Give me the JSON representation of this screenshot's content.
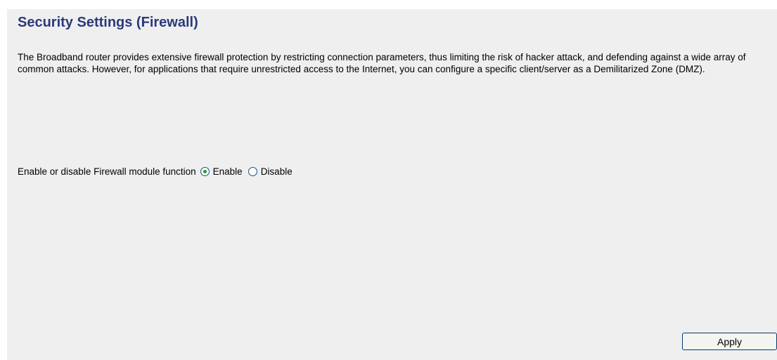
{
  "page": {
    "title": "Security Settings (Firewall)",
    "description": "The Broadband router provides extensive firewall protection by restricting connection parameters, thus limiting the risk of hacker attack, and defending against a wide array of common attacks. However, for applications that require unrestricted access to the Internet, you can configure a specific client/server as a Demilitarized Zone (DMZ)."
  },
  "firewall": {
    "label": "Enable or disable Firewall module function",
    "options": [
      {
        "label": "Enable",
        "selected": true
      },
      {
        "label": "Disable",
        "selected": false
      }
    ]
  },
  "actions": {
    "apply_label": "Apply"
  },
  "colors": {
    "title": "#2a3a79",
    "panel_background": "#efefef",
    "radio_selected": "#21a121"
  }
}
